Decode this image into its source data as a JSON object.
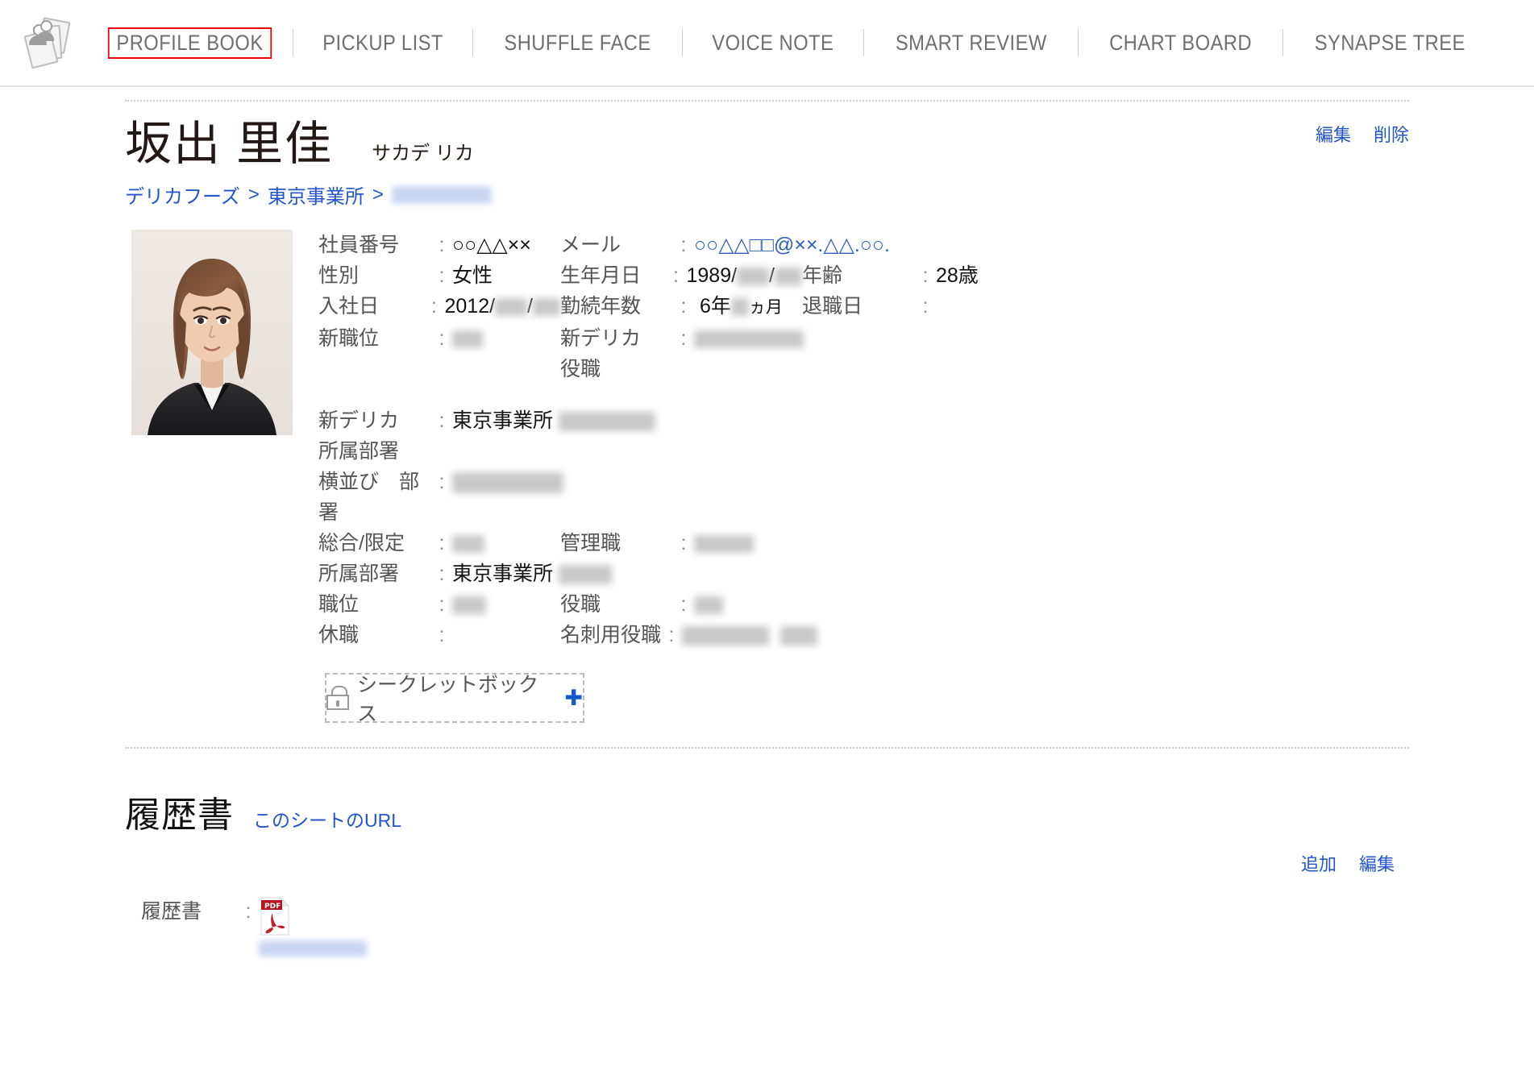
{
  "nav": {
    "logo_icon": "photo-cards-icon",
    "items": [
      {
        "label": "PROFILE BOOK",
        "active": true
      },
      {
        "label": "PICKUP LIST",
        "active": false
      },
      {
        "label": "SHUFFLE FACE",
        "active": false
      },
      {
        "label": "VOICE NOTE",
        "active": false
      },
      {
        "label": "SMART REVIEW",
        "active": false
      },
      {
        "label": "CHART BOARD",
        "active": false
      },
      {
        "label": "SYNAPSE TREE",
        "active": false
      }
    ],
    "active_outline_color": "#e8000d"
  },
  "profile": {
    "name_kanji": "坂出 里佳",
    "name_kana": "サカデ リカ",
    "actions": {
      "edit": "編集",
      "delete": "削除"
    },
    "breadcrumb": {
      "items": [
        "デリカフーズ",
        "東京事業所"
      ],
      "separator": ">",
      "redacted_tail": true
    },
    "photo_alt": "顔写真",
    "fields": {
      "employee_no": {
        "label": "社員番号",
        "value": "○○△△××"
      },
      "mail": {
        "label": "メール",
        "value": "○○△△□□@××.△△.○○."
      },
      "gender": {
        "label": "性別",
        "value": "女性"
      },
      "birthday": {
        "label": "生年月日",
        "value_prefix": "1989/",
        "redacted": true
      },
      "age": {
        "label": "年齢",
        "value": "28歳"
      },
      "join_date": {
        "label": "入社日",
        "value_prefix": "2012/",
        "redacted": true
      },
      "tenure": {
        "label": "勤続年数",
        "value_prefix": "6年",
        "value_suffix": "ヵ月",
        "redacted": true
      },
      "leave_date": {
        "label": "退職日",
        "value": ""
      },
      "new_position": {
        "label": "新職位",
        "value": "",
        "redacted": true
      },
      "new_delica_post": {
        "label": "新デリカ役職",
        "label_line1": "新デリカ",
        "label_line2": "役職",
        "value": "",
        "redacted": true
      },
      "new_delica_dept": {
        "label": "新デリカ所属部署",
        "label_line1": "新デリカ",
        "label_line2": "所属部署",
        "value": "東京事業所",
        "redacted": true
      },
      "row_dept": {
        "label": "横並び　部署",
        "label_line1": "横並び　部",
        "label_line2": "署",
        "value": "",
        "redacted": true
      },
      "track": {
        "label": "総合/限定",
        "value": "",
        "redacted": true
      },
      "manager": {
        "label": "管理職",
        "value": "",
        "redacted": true
      },
      "dept": {
        "label": "所属部署",
        "value": "東京事業所",
        "redacted": true
      },
      "position": {
        "label": "職位",
        "value": "",
        "redacted": true
      },
      "title": {
        "label": "役職",
        "value": "",
        "redacted": true
      },
      "leave_of_absence": {
        "label": "休職",
        "value": ""
      },
      "card_title": {
        "label": "名刺用役職",
        "value": "",
        "redacted": true
      }
    },
    "secret_box": {
      "label": "シークレットボックス",
      "lock_icon": "lock-icon",
      "plus_icon": "plus-icon",
      "plus_color": "#1159cc"
    }
  },
  "resume": {
    "title": "履歴書",
    "sheet_url_label": "このシートのURL",
    "actions": {
      "add": "追加",
      "edit": "編集"
    },
    "row": {
      "label": "履歴書",
      "file_icon": "pdf-file-icon",
      "file_name_redacted": true
    }
  }
}
